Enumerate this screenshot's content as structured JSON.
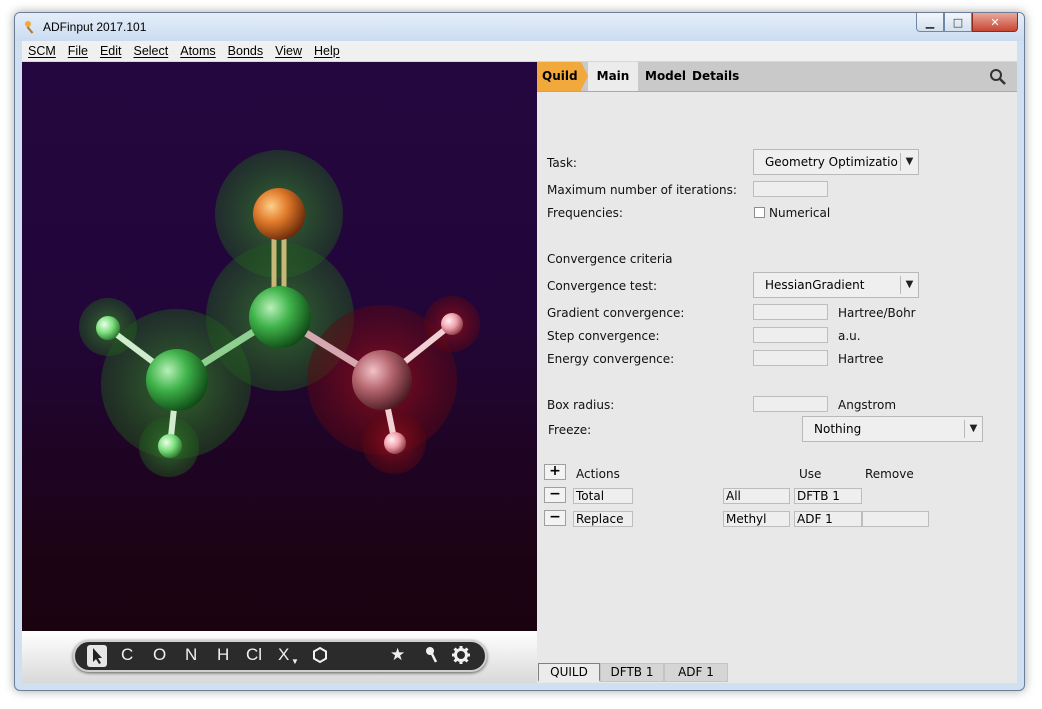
{
  "window": {
    "title": "ADFinput 2017.101"
  },
  "menu": [
    "SCM",
    "File",
    "Edit",
    "Select",
    "Atoms",
    "Bonds",
    "View",
    "Help"
  ],
  "toolbar": {
    "tools": [
      "C",
      "O",
      "N",
      "H",
      "Cl",
      "X",
      "★"
    ]
  },
  "tabs": {
    "quild": "Quild",
    "main": "Main",
    "model": "Model",
    "details": "Details"
  },
  "form": {
    "task_label": "Task:",
    "task_value": "Geometry Optimizatio",
    "max_iter_label": "Maximum number of iterations:",
    "frequencies_label": "Frequencies:",
    "numerical_label": "Numerical",
    "conv_criteria_label": "Convergence criteria",
    "conv_test_label": "Convergence test:",
    "conv_test_value": "HessianGradient",
    "gradient_label": "Gradient convergence:",
    "gradient_unit": "Hartree/Bohr",
    "step_label": "Step convergence:",
    "step_unit": "a.u.",
    "energy_label": "Energy convergence:",
    "energy_unit": "Hartree",
    "box_label": "Box radius:",
    "box_unit": "Angstrom",
    "freeze_label": "Freeze:",
    "freeze_value": "Nothing"
  },
  "actions": {
    "add": "+",
    "header": "Actions",
    "use_header": "Use",
    "remove_header": "Remove",
    "rows": [
      {
        "remove": "−",
        "action": "Total",
        "region": "All",
        "use": "DFTB 1",
        "remove_value": ""
      },
      {
        "remove": "−",
        "action": "Replace",
        "region": "Methyl",
        "use": "ADF 1",
        "remove_value": ""
      }
    ]
  },
  "bottom_tabs": [
    "QUILD",
    "DFTB 1",
    "ADF 1"
  ],
  "colors": {
    "quild_tab": "#f0a93a",
    "viewport_top": "#23073e",
    "viewport_bottom": "#1a020b"
  }
}
